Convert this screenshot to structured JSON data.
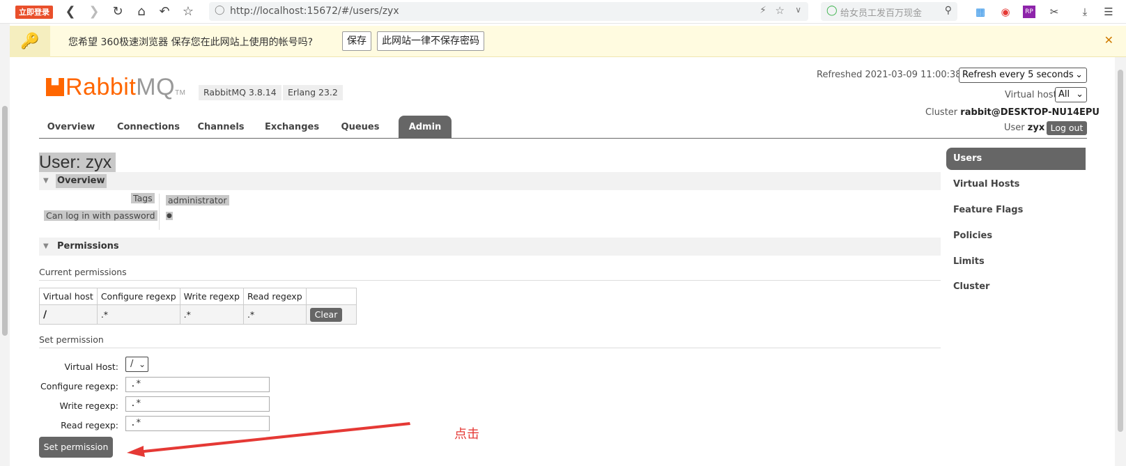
{
  "browser": {
    "login_badge": "立即登录",
    "url": "http://localhost:15672/#/users/zyx",
    "search_placeholder": "给女员工发百万现金"
  },
  "password_bar": {
    "message": "您希望 360极速浏览器 保存您在此网站上使用的帐号吗?",
    "save_label": "保存",
    "never_label": "此网站一律不保存密码",
    "close": "✕"
  },
  "header": {
    "logo_main": "Rabbit",
    "logo_mq": "MQ",
    "logo_tm": "TM",
    "version": "RabbitMQ 3.8.14",
    "erlang": "Erlang 23.2",
    "refreshed": "Refreshed 2021-03-09 11:00:38",
    "refresh_select": "Refresh every 5 seconds",
    "vhost_label": "Virtual host",
    "vhost_value": "All",
    "cluster_label": "Cluster",
    "cluster_value": "rabbit@DESKTOP-NU14EPU",
    "user_label": "User",
    "user_value": "zyx",
    "logout": "Log out"
  },
  "nav": {
    "tabs": [
      "Overview",
      "Connections",
      "Channels",
      "Exchanges",
      "Queues",
      "Admin"
    ],
    "active": "Admin"
  },
  "page": {
    "title": "User: zyx",
    "overview": {
      "heading": "Overview",
      "tags_label": "Tags",
      "tags_value": "administrator",
      "login_label": "Can log in with password",
      "login_value": "●"
    },
    "permissions": {
      "heading": "Permissions",
      "current_label": "Current permissions",
      "columns": [
        "Virtual host",
        "Configure regexp",
        "Write regexp",
        "Read regexp"
      ],
      "rows": [
        {
          "vhost": "/",
          "configure": ".*",
          "write": ".*",
          "read": ".*",
          "action": "Clear"
        }
      ],
      "set_label": "Set permission",
      "form": {
        "vhost_label": "Virtual Host:",
        "vhost_value": "/",
        "configure_label": "Configure regexp:",
        "configure_value": ".*",
        "write_label": "Write regexp:",
        "write_value": ".*",
        "read_label": "Read regexp:",
        "read_value": ".*",
        "submit": "Set permission"
      }
    },
    "annotation": "点击"
  },
  "sidebar": {
    "items": [
      "Users",
      "Virtual Hosts",
      "Feature Flags",
      "Policies",
      "Limits",
      "Cluster"
    ],
    "active": "Users"
  },
  "colors": {
    "brand": "#ff6600",
    "nav_active": "#666666",
    "annotation": "#e53935"
  }
}
